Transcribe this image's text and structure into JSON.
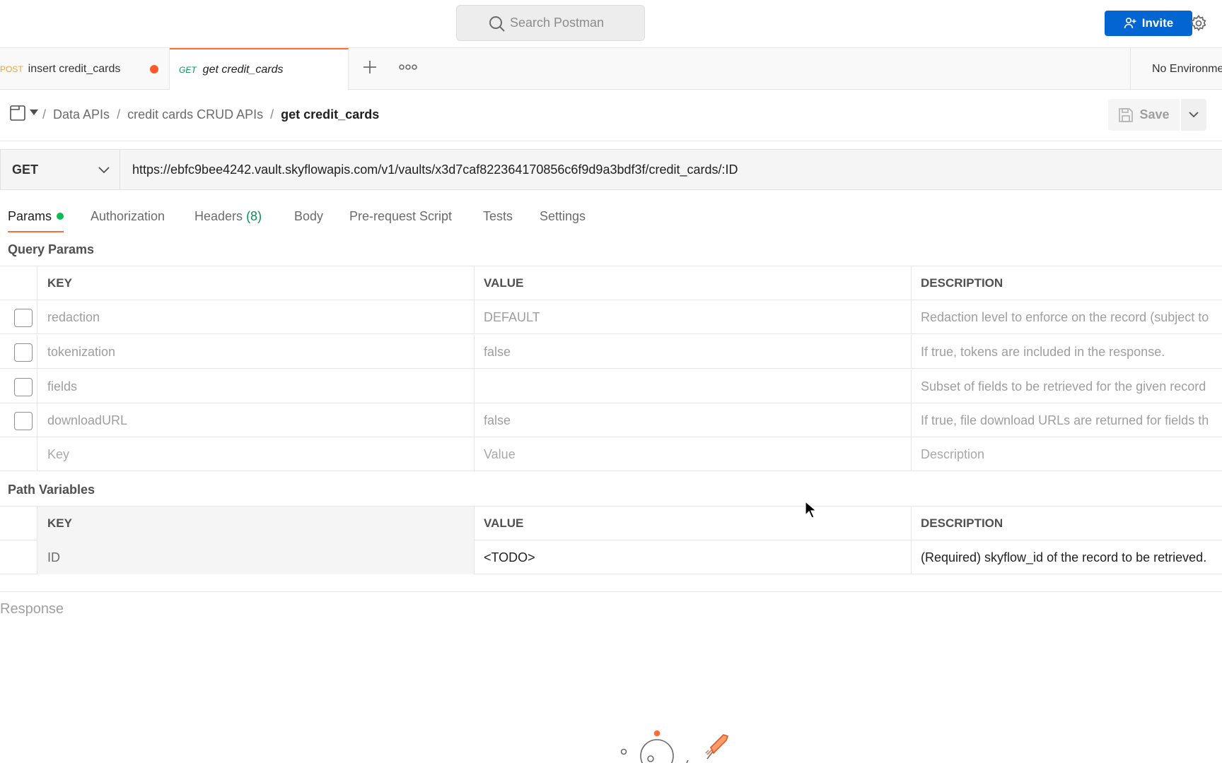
{
  "header": {
    "search_placeholder": "Search Postman",
    "invite_label": "Invite"
  },
  "tabs": [
    {
      "method": "POST",
      "name": "insert credit_cards",
      "unsaved": true
    },
    {
      "method": "GET",
      "name": "get credit_cards",
      "active": true
    }
  ],
  "environment": {
    "label": "No Environment"
  },
  "breadcrumb": {
    "items": [
      "Data APIs",
      "credit cards CRUD APIs"
    ],
    "current": "get credit_cards",
    "separator": "/"
  },
  "toolbar": {
    "save_label": "Save"
  },
  "request": {
    "method": "GET",
    "url": "https://ebfc9bee4242.vault.skyflowapis.com/v1/vaults/x3d7caf822364170856c6f9d9a3bdf3f/credit_cards/:ID"
  },
  "request_tabs": {
    "params": "Params",
    "authorization": "Authorization",
    "headers": "Headers",
    "headers_count": "(8)",
    "body": "Body",
    "prerequest": "Pre-request Script",
    "tests": "Tests",
    "settings": "Settings"
  },
  "query_params": {
    "title": "Query Params",
    "columns": {
      "key": "KEY",
      "value": "VALUE",
      "description": "DESCRIPTION"
    },
    "rows": [
      {
        "key": "redaction",
        "value": "DEFAULT",
        "description": "Redaction level to enforce on the record (subject to"
      },
      {
        "key": "tokenization",
        "value": "false",
        "description": "If true, tokens are included in the response."
      },
      {
        "key": "fields",
        "value": "",
        "description": "Subset of fields to be retrieved for the given record"
      },
      {
        "key": "downloadURL",
        "value": "false",
        "description": "If true, file download URLs are returned for fields th"
      }
    ],
    "placeholder": {
      "key": "Key",
      "value": "Value",
      "description": "Description"
    }
  },
  "path_variables": {
    "title": "Path Variables",
    "columns": {
      "key": "KEY",
      "value": "VALUE",
      "description": "DESCRIPTION"
    },
    "rows": [
      {
        "key": "ID",
        "value": "<TODO>",
        "description": "(Required) skyflow_id of the record to be retrieved."
      }
    ]
  },
  "response": {
    "label": "Response"
  },
  "colors": {
    "accent": "#ff6c37",
    "invite_blue": "#0265d2",
    "get_green": "#0b8e5b",
    "post_orange": "#f0a52a",
    "active_dot": "#0cbb52"
  }
}
